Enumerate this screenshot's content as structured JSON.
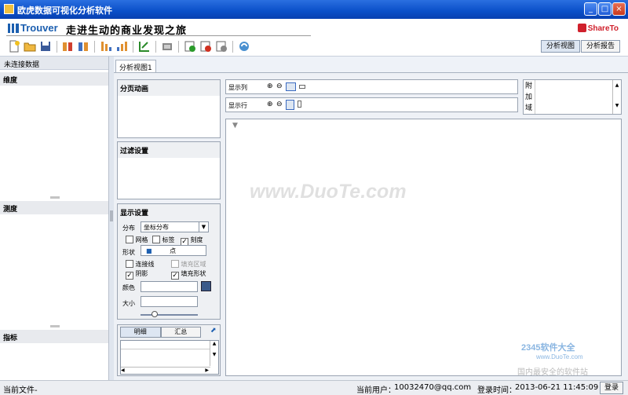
{
  "window": {
    "title": "欧虎数据可视化分析软件"
  },
  "banner": {
    "logo": "Trouver",
    "slogan": "走进生动的商业发现之旅",
    "share": "ShareTo"
  },
  "toolbar": {
    "icons": [
      "new-icon",
      "open-icon",
      "save-icon",
      "import-icon",
      "export-icon",
      "sort-desc-icon",
      "sort-asc-icon",
      "swap-axes-icon",
      "screenshot-icon",
      "add-view-icon",
      "delete-view-icon",
      "copy-view-icon",
      "refresh-icon"
    ],
    "view_buttons": [
      "分析视图",
      "分析报告"
    ]
  },
  "left_panel": {
    "header": "未连接数据",
    "sections": [
      "维度",
      "测度",
      "指标"
    ]
  },
  "tabs": [
    "分析视图1"
  ],
  "panels": {
    "page_animation": "分页动画",
    "filter_settings": "过滤设置",
    "display_settings": "显示设置"
  },
  "display": {
    "distribution_label": "分布",
    "distribution_value": "坐标分布",
    "checks": [
      {
        "label": "网格",
        "checked": false
      },
      {
        "label": "标签",
        "checked": false
      },
      {
        "label": "刻度",
        "checked": true
      }
    ],
    "shape_label": "形状",
    "shape_value": "点",
    "checks2": [
      {
        "label": "连接线",
        "checked": false
      },
      {
        "label": "填充区域",
        "checked": false,
        "disabled": true
      },
      {
        "label": "阴影",
        "checked": true
      },
      {
        "label": "填充形状",
        "checked": true
      }
    ],
    "color_label": "颜色",
    "size_label": "大小",
    "slider_value": 0.25
  },
  "bottom_tabs": [
    "明细",
    "汇总"
  ],
  "shelves": {
    "columns": "显示列",
    "rows": "显示行"
  },
  "extra_area": "附加域",
  "watermark": "www.DuoTe.com",
  "watermark2": {
    "brand": "2345软件大全",
    "url": "www.DuoTe.com",
    "tagline": "国内最安全的软件站"
  },
  "status": {
    "file": "当前文件-",
    "user_label": "当前用户：",
    "user": "10032470@qq.com",
    "login_time_label": "登录时间：",
    "login_time": "2013-06-21 11:45:09",
    "login_button": "登录"
  },
  "colors": {
    "title_bar": "#0a4fc8",
    "brand": "#1c5fb0",
    "share": "#d0202c"
  }
}
